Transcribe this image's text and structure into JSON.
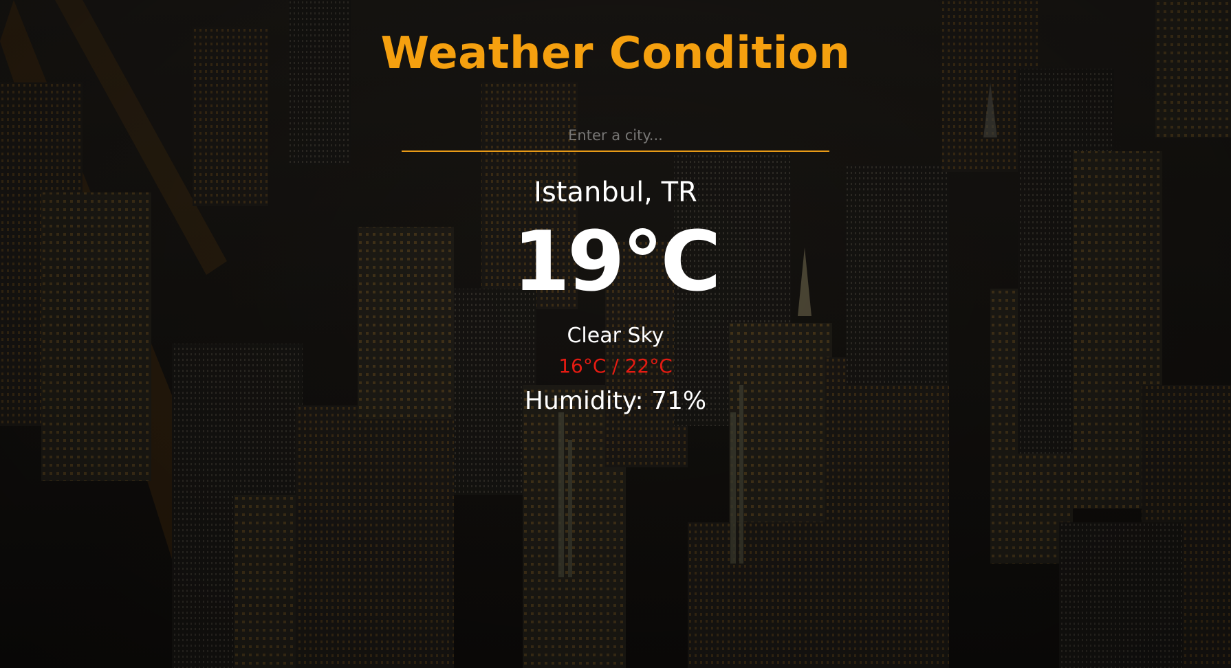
{
  "app": {
    "title": "Weather Condition"
  },
  "search": {
    "placeholder": "Enter a city...",
    "value": ""
  },
  "weather": {
    "location": "Istanbul, TR",
    "temperature": "19°C",
    "condition": "Clear Sky",
    "min_max": "16°C / 22°C",
    "humidity": "Humidity: 71%"
  },
  "colors": {
    "accent": "#f5a00f",
    "min_max": "#e51b12",
    "text": "#ffffff",
    "background": "#141210"
  },
  "background_image": "night city aerial skyline"
}
